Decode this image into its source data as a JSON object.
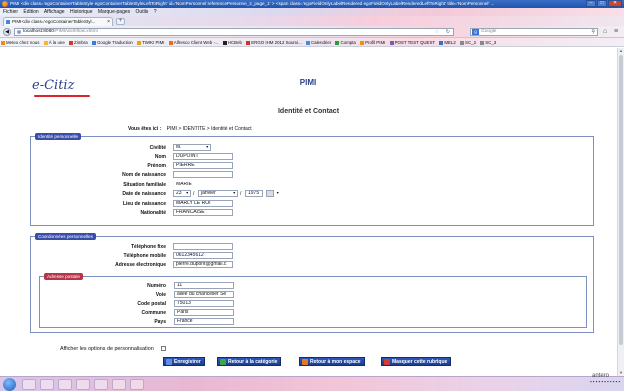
{
  "browser": {
    "title": "PIMI <div class='egoContainerTableStyle egoContainerTableStyleLeftToRight' id='NomPersonnel:referencePersonne_2_page_1' > <span class='egoFieldOnlyLabelRendered egoFieldOnlyLabelRenderedLeftToRight' title='NomPersonnel' ...",
    "menu": [
      "Fichier",
      "Édition",
      "Affichage",
      "Historique",
      "Marque-pages",
      "Outils",
      "?"
    ],
    "tab_title": "PIMI<div class='egoContainerTableStyl...",
    "url_host": "localhost:8080",
    "url_path": "/PIMI/workflow.xhtml",
    "search_placeholder": "Google",
    "bookmarks": [
      "Meteo chez nous",
      "À la une",
      "Zimbra",
      "Google Traduction",
      "TWIKI PIMI",
      "Alfresco Client Web -...",
      "HCBeb",
      "ERGO IHM 2012 Soumi...",
      "Calendrier",
      "Compta",
      "Profil PIMI",
      "POST TEST QUEST",
      "MEL2",
      "SC_2",
      "SC_3"
    ]
  },
  "header": {
    "logo": "e-Citiz",
    "app_title": "PIMI"
  },
  "page": {
    "title": "Identité et Contact",
    "breadcrumb_label": "Vous êtes ici :",
    "breadcrumb_path": "PIMI > IDENTITE > Identité et Contact"
  },
  "identite": {
    "legend": "Identité personnelle",
    "civilite_label": "Civilité",
    "civilite_value": "M.",
    "nom_label": "Nom",
    "nom_value": "DUPOINT",
    "prenom_label": "Prénom",
    "prenom_value": "PIERRE",
    "nom_naissance_label": "Nom de naissance",
    "nom_naissance_value": "",
    "situation_label": "Situation familiale",
    "situation_value": "MARIE",
    "date_label": "Date de naissance",
    "date_day": "23",
    "date_sep": "/",
    "date_month": "janvier",
    "date_year": "1975",
    "lieu_label": "Lieu de naissance",
    "lieu_value": "MARLY LE ROI",
    "nationalite_label": "Nationalité",
    "nationalite_value": "FRANCAISE"
  },
  "coordonnees": {
    "legend": "Coordonnées personnelles",
    "tel_fixe_label": "Téléphone fixe",
    "tel_fixe_value": "",
    "tel_mobile_label": "Téléphone mobile",
    "tel_mobile_value": "0612345612",
    "email_label": "Adresse électronique",
    "email_value": "pierre.dupont@gmail.c"
  },
  "adresse": {
    "legend": "Adresse postale",
    "numero_label": "Numéro",
    "numero_value": "11",
    "voie_label": "Voie",
    "voie_value": "allée du chancelier Sé",
    "cp_label": "Code postal",
    "cp_value": "75013",
    "commune_label": "Commune",
    "commune_value": "Paris",
    "pays_label": "Pays",
    "pays_value": "France"
  },
  "options": {
    "label": "Afficher les options de personnalisation"
  },
  "buttons": {
    "enregistrer": "Enregistrer",
    "retour_categorie": "Retour à la catégorie",
    "retour_espace": "Retour à mon espace",
    "masquer": "Masquer cette rubrique"
  },
  "taskbar": {
    "corner_text": "antero"
  },
  "colors": {
    "brand_blue": "#2b3f8c",
    "legend_blue": "#3a4da8",
    "legend_red": "#b7354a",
    "button_blue": "#1c3d8f"
  }
}
